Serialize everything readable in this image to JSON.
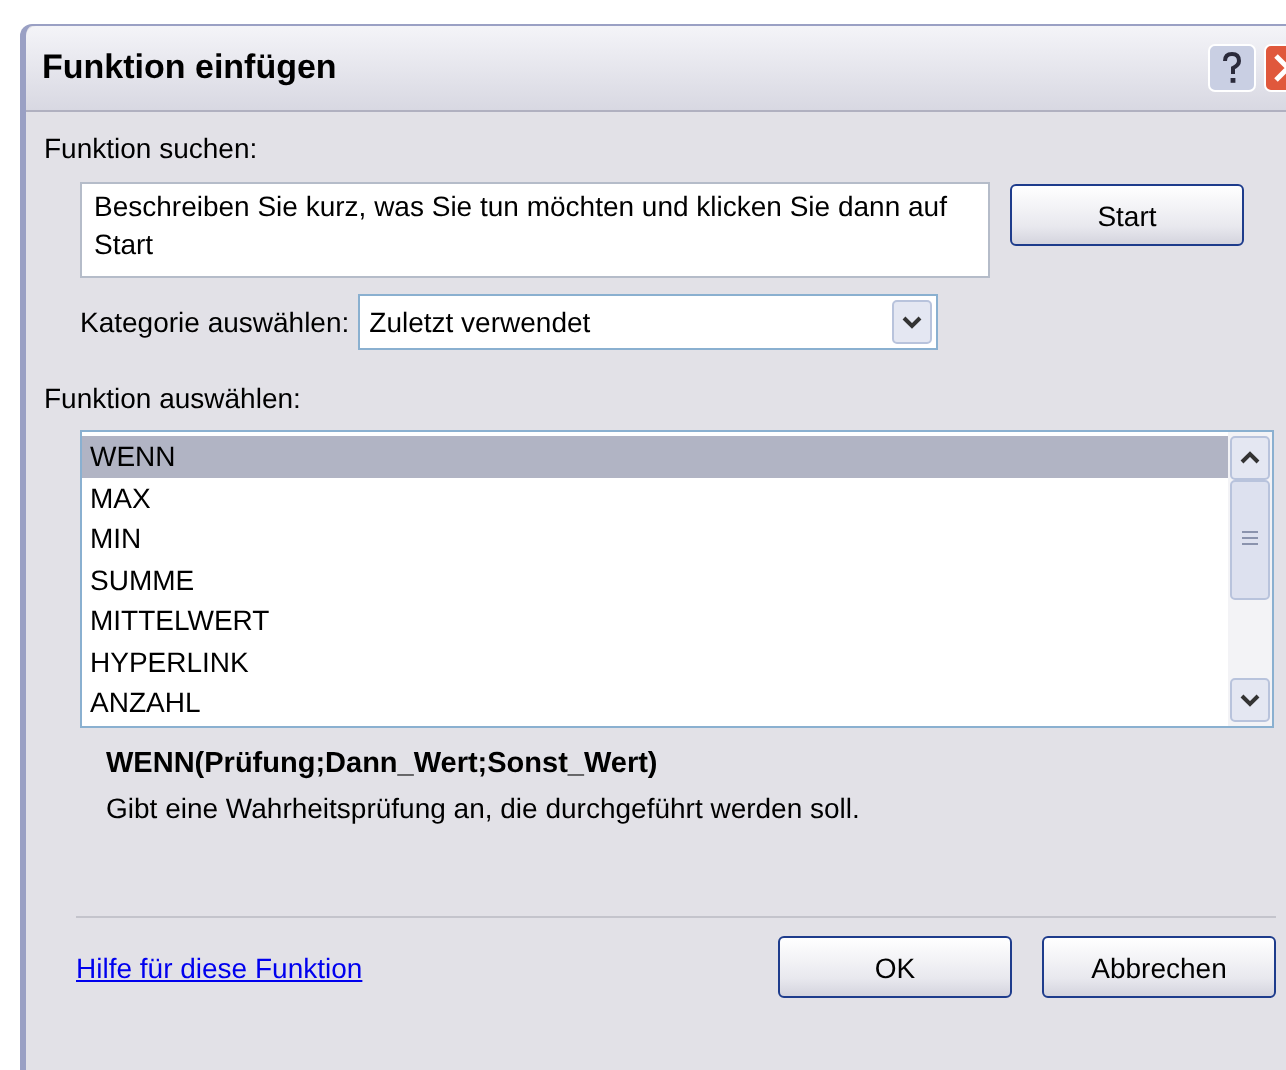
{
  "window": {
    "title": "Funktion einfügen"
  },
  "search": {
    "label": "Funktion suchen:",
    "value": "Beschreiben Sie kurz, was Sie tun möchten und klicken Sie dann auf Start",
    "button": "Start"
  },
  "category": {
    "label": "Kategorie auswählen:",
    "value": "Zuletzt verwendet"
  },
  "functions": {
    "label": "Funktion auswählen:",
    "items": [
      {
        "name": "WENN",
        "selected": true
      },
      {
        "name": "MAX",
        "selected": false
      },
      {
        "name": "MIN",
        "selected": false
      },
      {
        "name": "SUMME",
        "selected": false
      },
      {
        "name": "MITTELWERT",
        "selected": false
      },
      {
        "name": "HYPERLINK",
        "selected": false
      },
      {
        "name": "ANZAHL",
        "selected": false
      }
    ]
  },
  "syntax": "WENN(Prüfung;Dann_Wert;Sonst_Wert)",
  "description": "Gibt eine Wahrheitsprüfung an, die durchgeführt werden soll.",
  "help_link": "Hilfe für diese Funktion",
  "buttons": [
    "OK",
    "Abbrechen"
  ]
}
